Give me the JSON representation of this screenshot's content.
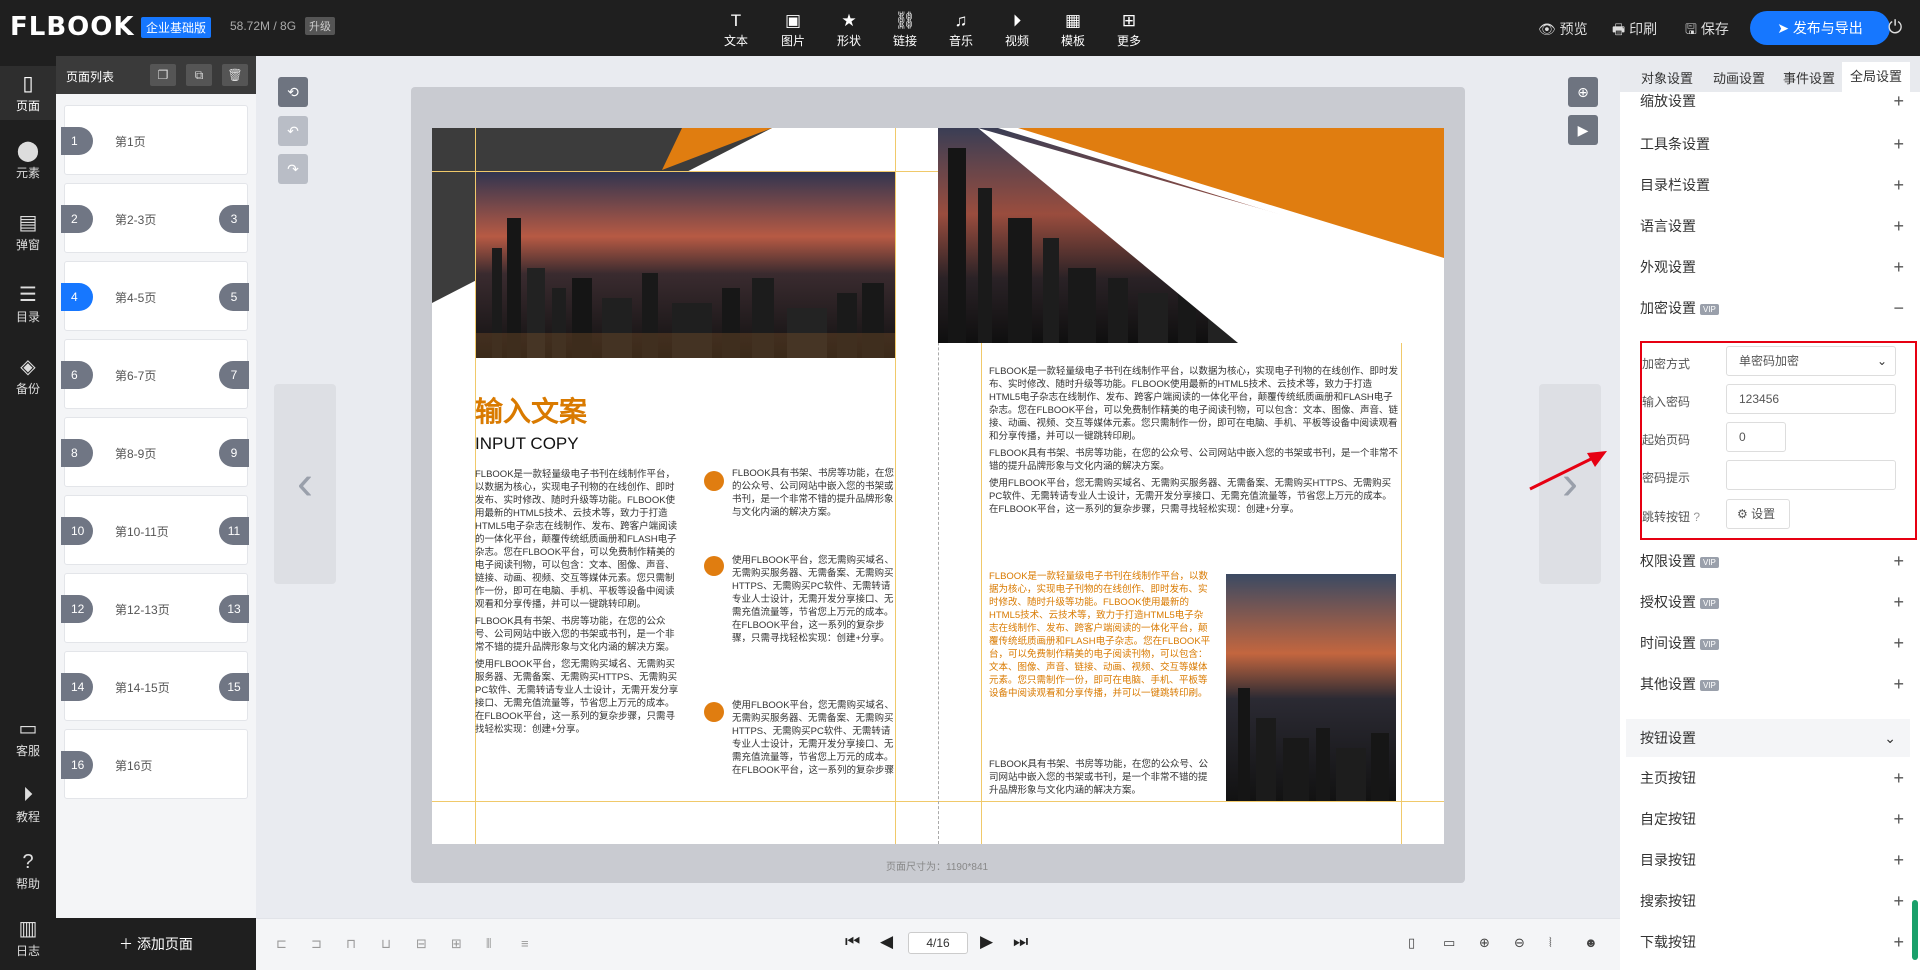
{
  "app": {
    "logo": "FLBOOK",
    "edition": "企业基础版",
    "storage": "58.72M / 8G",
    "upgrade": "升级"
  },
  "toolbar": {
    "items": [
      {
        "label": "文本",
        "icon": "text-icon"
      },
      {
        "label": "图片",
        "icon": "image-icon"
      },
      {
        "label": "形状",
        "icon": "star-icon"
      },
      {
        "label": "链接",
        "icon": "link-icon"
      },
      {
        "label": "音乐",
        "icon": "music-icon"
      },
      {
        "label": "视频",
        "icon": "play-icon"
      },
      {
        "label": "模板",
        "icon": "template-icon"
      },
      {
        "label": "更多",
        "icon": "grid-icon"
      }
    ],
    "preview": "预览",
    "print": "印刷",
    "save": "保存",
    "publish": "发布与导出"
  },
  "leftnav": {
    "items": [
      "页面",
      "元素",
      "弹窗",
      "目录",
      "备份"
    ],
    "bottom": [
      "客服",
      "教程",
      "帮助",
      "日志"
    ]
  },
  "pagelist": {
    "title": "页面列表",
    "pages": [
      {
        "n": "1",
        "label": "第1页",
        "m": ""
      },
      {
        "n": "2",
        "label": "第2-3页",
        "m": "3"
      },
      {
        "n": "4",
        "label": "第4-5页",
        "m": "5"
      },
      {
        "n": "6",
        "label": "第6-7页",
        "m": "7"
      },
      {
        "n": "8",
        "label": "第8-9页",
        "m": "9"
      },
      {
        "n": "10",
        "label": "第10-11页",
        "m": "11"
      },
      {
        "n": "12",
        "label": "第12-13页",
        "m": "13"
      },
      {
        "n": "14",
        "label": "第14-15页",
        "m": "15"
      },
      {
        "n": "16",
        "label": "第16页",
        "m": ""
      }
    ],
    "add": "添加页面"
  },
  "canvas": {
    "size_info": "页面尺寸为：1190*841",
    "left_page": {
      "title_cn": "输入文案",
      "title_en": "INPUT COPY",
      "col1_p1": "FLBOOK是一款轻量级电子书刊在线制作平台，以数据为核心，实现电子刊物的在线创作、即时发布、实时修改、随时升级等功能。FLBOOK使用最新的HTML5技术、云技术等，致力于打造HTML5电子杂志在线制作、发布、跨客户端阅读的一体化平台，颠覆传统纸质画册和FLASH电子杂志。您在FLBOOK平台，可以免费制作精美的电子阅读刊物，可以包含：文本、图像、声音、链接、动画、视频、交互等媒体元素。您只需制作一份，即可在电脑、手机、平板等设备中阅读观看和分享传播，并可以一键跳转印刷。",
      "col1_p2": "FLBOOK具有书架、书房等功能，在您的公众号、公司网站中嵌入您的书架或书刊，是一个非常不错的提升品牌形象与文化内涵的解决方案。",
      "col1_p3": "使用FLBOOK平台，您无需购买域名、无需购买服务器、无需备案、无需购买HTTPS、无需购买PC软件、无需转请专业人士设计，无需开发分享接口、无需充值流量等，节省您上万元的成本。在FLBOOK平台，这一系列的复杂步骤，只需寻找轻松实现：创建+分享。",
      "b1": "FLBOOK具有书架、书房等功能，在您的公众号、公司网站中嵌入您的书架或书刊，是一个非常不错的提升品牌形象与文化内涵的解决方案。",
      "b2": "使用FLBOOK平台，您无需购买域名、无需购买服务器、无需备案、无需购买HTTPS、无需购买PC软件、无需转请专业人士设计，无需开发分享接口、无需充值流量等，节省您上万元的成本。在FLBOOK平台，这一系列的复杂步骤，只需寻找轻松实现：创建+分享。",
      "b3": "使用FLBOOK平台，您无需购买域名、无需购买服务器、无需备案、无需购买HTTPS、无需购买PC软件、无需转请专业人士设计，无需开发分享接口、无需充值流量等，节省您上万元的成本。在FLBOOK平台，这一系列的复杂步骤"
    },
    "right_page": {
      "p1": "FLBOOK是一款轻量级电子书刊在线制作平台，以数据为核心，实现电子刊物的在线创作、即时发布、实时修改、随时升级等功能。FLBOOK使用最新的HTML5技术、云技术等，致力于打造HTML5电子杂志在线制作、发布、跨客户端阅读的一体化平台，颠覆传统纸质画册和FLASH电子杂志。您在FLBOOK平台，可以免费制作精美的电子阅读刊物，可以包含：文本、图像、声音、链接、动画、视频、交互等媒体元素。您只需制作一份，即可在电脑、手机、平板等设备中阅读观看和分享传播，并可以一键跳转印刷。",
      "p2": "FLBOOK具有书架、书房等功能，在您的公众号、公司网站中嵌入您的书架或书刊，是一个非常不错的提升品牌形象与文化内涵的解决方案。",
      "p3": "使用FLBOOK平台，您无需购买域名、无需购买服务器、无需备案、无需购买HTTPS、无需购买PC软件、无需转请专业人士设计，无需开发分享接口、无需充值流量等，节省您上万元的成本。在FLBOOK平台，这一系列的复杂步骤，只需寻找轻松实现：创建+分享。",
      "orange": "FLBOOK是一款轻量级电子书刊在线制作平台，以数据为核心，实现电子刊物的在线创作、即时发布、实时修改、随时升级等功能。FLBOOK使用最新的HTML5技术、云技术等，致力于打造HTML5电子杂志在线制作、发布、跨客户端阅读的一体化平台，颠覆传统纸质画册和FLASH电子杂志。您在FLBOOK平台，可以免费制作精美的电子阅读刊物，可以包含：文本、图像、声音、链接、动画、视频、交互等媒体元素。您只需制作一份，即可在电脑、手机、平板等设备中阅读观看和分享传播，并可以一键跳转印刷。",
      "p4": "FLBOOK具有书架、书房等功能，在您的公众号、公司网站中嵌入您的书架或书刊，是一个非常不错的提升品牌形象与文化内涵的解决方案。"
    }
  },
  "bottombar": {
    "page_value": "4/16"
  },
  "rpanel": {
    "tabs": [
      "对象设置",
      "动画设置",
      "事件设置",
      "全局设置"
    ],
    "rows_top": [
      "缩放设置",
      "工具条设置",
      "目录栏设置",
      "语言设置",
      "外观设置"
    ],
    "encrypt_label": "加密设置",
    "encrypt": {
      "method_label": "加密方式",
      "method_value": "单密码加密",
      "pwd_label": "输入密码",
      "pwd_value": "123456",
      "start_label": "起始页码",
      "start_value": "0",
      "hint_label": "密码提示",
      "hint_value": "",
      "jump_label": "跳转按钮",
      "set_label": "设置"
    },
    "rows_mid": [
      "权限设置",
      "授权设置",
      "时间设置",
      "其他设置"
    ],
    "vip": "VIP",
    "button_section": "按钮设置",
    "rows_btn": [
      "主页按钮",
      "自定按钮",
      "目录按钮",
      "搜索按钮",
      "下载按钮"
    ]
  },
  "colors": {
    "accent": "#1677ff",
    "orange": "#e07d10",
    "highlight": "#e60012"
  }
}
